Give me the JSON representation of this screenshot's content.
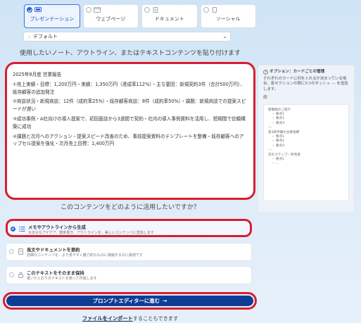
{
  "format_tabs": [
    {
      "label": "プレゼンテーション",
      "active": true
    },
    {
      "label": "ウェブページ",
      "active": false
    },
    {
      "label": "ドキュメント",
      "active": false
    },
    {
      "label": "ソーシャル",
      "active": false
    }
  ],
  "template_select": {
    "grip": "::",
    "value": "デフォルト"
  },
  "instruction": "使用したいノート、アウトライン、またはテキストコンテンツを貼り付けます",
  "content_paragraphs": [
    "2025年8月度 営業報告",
    "①売上実績・目標：1,200万円・実績：1,350万円（達成率112%）・主な要因：新規契約3件（合計500万円）、既存顧客の追加発注",
    "②商談状況・新規商談：12件（成約率25%）・既存顧客商談：8件（成約率50%）・課題：新規商談での提案スピードが遅い",
    "③成功事例・A社向けの導入提案で、初回面談から3週間で契約・社内の導入事例資料を活用し、短期間で信頼構築に成功",
    "④課題と次月へのアクション・提案スピード改善のため、事前提案資料のテンプレートを整備・既存顧客へのアップセル提案を強化・次月売上目標：1,400万円"
  ],
  "side_panel": {
    "title": "オプション：カードごとの管理",
    "description": "それぞれのカードに何を入れるか決まっている場合、各セクションの間に3つのダッシュ --- を追加します。",
    "example_label": "例：",
    "sample_lines": [
      {
        "text": "新機能のご紹介",
        "indent": false
      },
      {
        "text": "・ 要点1",
        "indent": true
      },
      {
        "text": "・ 要点2",
        "indent": true
      },
      {
        "text": "・ 要点3",
        "indent": true
      },
      {
        "text": "---",
        "indent": false
      },
      {
        "text": "第3四半期の主要指標",
        "indent": false
      },
      {
        "text": "・ 要点1",
        "indent": true
      },
      {
        "text": "・ 要点2",
        "indent": true
      },
      {
        "text": "・ 要点3",
        "indent": true
      },
      {
        "text": "---",
        "indent": false
      },
      {
        "text": "次のステップ・所有者",
        "indent": false
      },
      {
        "text": "・ 要点1",
        "indent": true
      },
      {
        "text": "・ ...",
        "indent": true
      }
    ]
  },
  "question": "このコンテンツをどのように活用したいですか？",
  "options": [
    {
      "title": "メモやアウトラインから生成",
      "description": "大まかなアイデア、箇条書き、アウトラインを、美しいコンテンツに変換します",
      "selected": true,
      "icon": "list-icon"
    },
    {
      "title": "長文やドキュメントを要約",
      "description": "詳細なコンテンツを、より見やすく魅力的なものに凝縮するのに最適です",
      "selected": false,
      "icon": "document-icon"
    },
    {
      "title": "このテキストをそのまま保持",
      "description": "書いたとおりのテキストを使って作成します",
      "selected": false,
      "icon": "lock-icon"
    }
  ],
  "proceed_button": {
    "label": "プロンプトエディターに進む",
    "arrow": "→"
  },
  "import_line": {
    "link": "ファイルをインポート",
    "suffix": "することもできます"
  },
  "colors": {
    "accent": "#2f66d5",
    "primary_button": "#0e3d95",
    "highlight_outline": "#d81e2e"
  }
}
